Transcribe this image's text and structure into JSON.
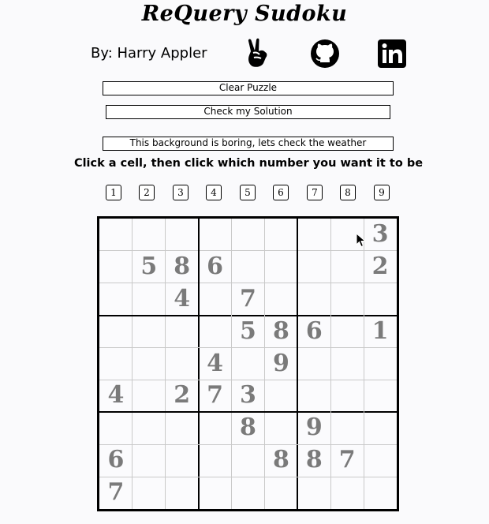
{
  "title": "ReQuery Sudoku",
  "byline": "By: Harry Appler",
  "icons": [
    "peace-hand-icon",
    "github-icon",
    "linkedin-icon"
  ],
  "buttons": {
    "clear": "Clear Puzzle",
    "check": "Check my Solution",
    "weather": "This background is boring, lets check the weather"
  },
  "instruction": "Click a cell, then click which number you want it to be",
  "number_buttons": [
    "1",
    "2",
    "3",
    "4",
    "5",
    "6",
    "7",
    "8",
    "9"
  ],
  "board": [
    [
      "",
      "",
      "",
      "",
      "",
      "",
      "",
      "",
      "3"
    ],
    [
      "",
      "5",
      "8",
      "6",
      "",
      "",
      "",
      "",
      "2"
    ],
    [
      "",
      "",
      "4",
      "",
      "7",
      "",
      "",
      "",
      ""
    ],
    [
      "",
      "",
      "",
      "",
      "5",
      "8",
      "6",
      "",
      "1"
    ],
    [
      "",
      "",
      "",
      "4",
      "",
      "9",
      "",
      "",
      ""
    ],
    [
      "4",
      "",
      "2",
      "7",
      "3",
      "",
      "",
      "",
      ""
    ],
    [
      "",
      "",
      "",
      "",
      "8",
      "",
      "9",
      "",
      ""
    ],
    [
      "6",
      "",
      "",
      "",
      "",
      "8",
      "8",
      "7",
      ""
    ],
    [
      "7",
      "",
      "",
      "",
      "",
      "",
      "",
      "",
      ""
    ]
  ],
  "colors": {
    "given_digit": "#7a7a7a",
    "thick_line": "#000000",
    "thin_line": "#c9c9c9"
  }
}
